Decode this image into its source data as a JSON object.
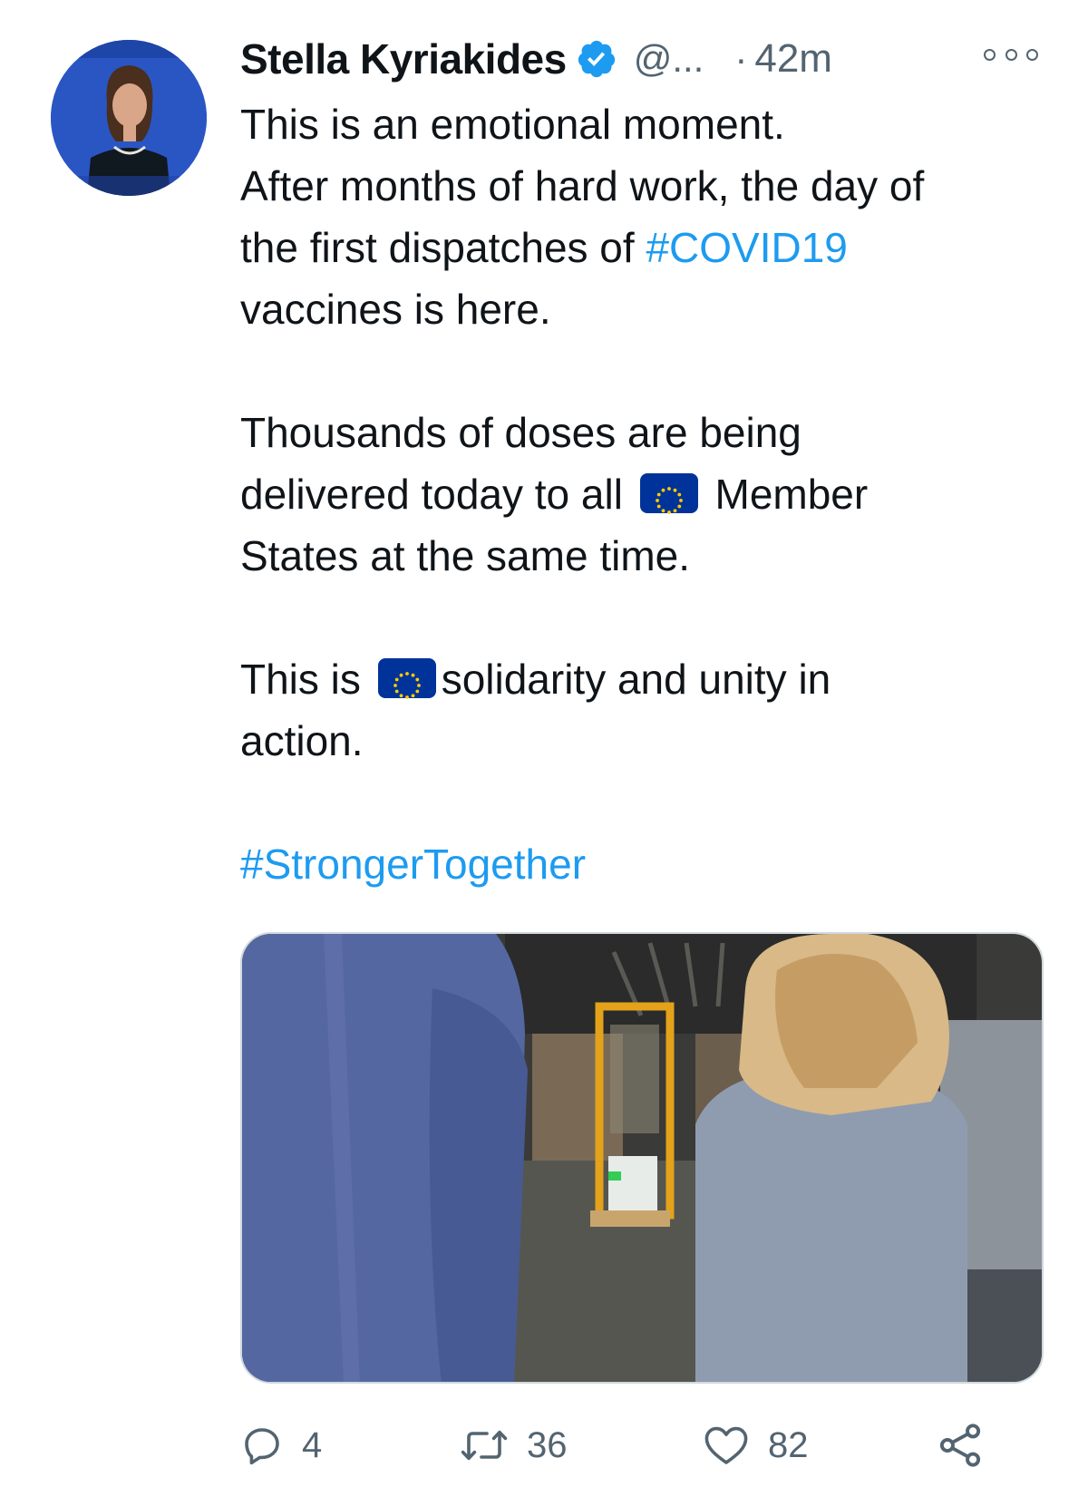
{
  "tweet": {
    "author": {
      "name": "Stella Kyriakides",
      "handle": "@...",
      "verified": true,
      "avatar_icon": "profile-photo"
    },
    "time_separator": "·",
    "timestamp": "42m",
    "more_icon": "ellipsis-icon",
    "text": {
      "p1_l1": "This is an emotional moment.",
      "p1_l2": "After months of hard work, the day of",
      "p1_l3_pre": "the first dispatches of ",
      "p1_l3_tag": "#COVID19",
      "p1_l4": "vaccines is here.",
      "p2_l1": "Thousands of doses are being",
      "p2_l2_pre": "delivered today to all",
      "p2_l2_post": "Member",
      "p2_l3": "States at the same time.",
      "p3_l1_pre": "This is",
      "p3_l1_post": "solidarity and unity in",
      "p3_l2": "action.",
      "p4_tag": "#StrongerTogether"
    },
    "flag_icon": "eu-flag-emoji",
    "media_icon": "photo-warehouse-vaccine-dispatch",
    "actions": {
      "reply_count": "4",
      "retweet_count": "36",
      "like_count": "82"
    },
    "colors": {
      "link": "#1d9bf0",
      "verified": "#1d9bf0",
      "secondary": "#536471",
      "eu_blue": "#003399",
      "eu_star": "#ffcc00"
    }
  }
}
